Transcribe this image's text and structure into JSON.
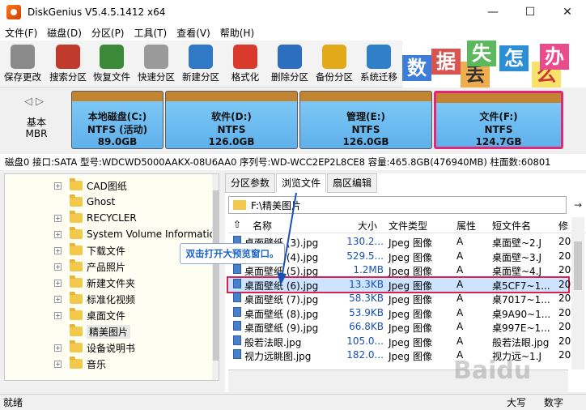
{
  "window": {
    "title": "DiskGenius V5.4.5.1412 x64",
    "minimize": "—",
    "maximize": "☐",
    "close": "✕"
  },
  "menu": [
    "文件(F)",
    "磁盘(D)",
    "分区(P)",
    "工具(T)",
    "查看(V)",
    "帮助(H)"
  ],
  "toolbar": [
    {
      "label": "保存更改",
      "color": "#8a8a8a"
    },
    {
      "label": "搜索分区",
      "color": "#c0392b"
    },
    {
      "label": "恢复文件",
      "color": "#3a8a3a"
    },
    {
      "label": "快速分区",
      "color": "#9a9a9a"
    },
    {
      "label": "新建分区",
      "color": "#2f79c6"
    },
    {
      "label": "格式化",
      "color": "#d93a2b"
    },
    {
      "label": "删除分区",
      "color": "#2c6fc0"
    },
    {
      "label": "备份分区",
      "color": "#e2a91b"
    },
    {
      "label": "系统迁移",
      "color": "#2f80c9"
    }
  ],
  "banner": [
    "数",
    "据",
    "丢",
    "失",
    "怎",
    "么",
    "办"
  ],
  "disk": {
    "nav": "◁ ▷",
    "label_line1": "基本",
    "label_line2": "MBR",
    "partitions": [
      {
        "name": "本地磁盘(C:)",
        "fs": "NTFS (活动)",
        "size": "89.0GB"
      },
      {
        "name": "软件(D:)",
        "fs": "NTFS",
        "size": "126.0GB"
      },
      {
        "name": "管理(E:)",
        "fs": "NTFS",
        "size": "126.0GB"
      },
      {
        "name": "文件(F:)",
        "fs": "NTFS",
        "size": "124.7GB"
      }
    ],
    "info": "磁盘0 接口:SATA  型号:WDCWD5000AAKX-08U6AA0  序列号:WD-WCC2EP2L8CE8  容量:465.8GB(476940MB)  柱面数:60801"
  },
  "tree": [
    {
      "label": "CAD图纸",
      "expander": "+"
    },
    {
      "label": "Ghost",
      "expander": ""
    },
    {
      "label": "RECYCLER",
      "expander": "+"
    },
    {
      "label": "System Volume Informatio",
      "expander": "+"
    },
    {
      "label": "下载文件",
      "expander": "+"
    },
    {
      "label": "产品照片",
      "expander": "+"
    },
    {
      "label": "新建文件夹",
      "expander": "+"
    },
    {
      "label": "标准化视频",
      "expander": "+"
    },
    {
      "label": "桌面文件",
      "expander": "+"
    },
    {
      "label": "精美图片",
      "expander": ""
    },
    {
      "label": "设备说明书",
      "expander": "+"
    },
    {
      "label": "音乐",
      "expander": "+"
    }
  ],
  "tabs": [
    "分区参数",
    "浏览文件",
    "扇区编辑"
  ],
  "path": "F:\\精美图片",
  "columns": {
    "name": "名称",
    "size": "大小",
    "type": "文件类型",
    "attr": "属性",
    "short": "短文件名",
    "mod": "修"
  },
  "files": [
    {
      "name": "桌面壁纸 (3).jpg",
      "size": "130.2...",
      "type": "Jpeg 图像",
      "attr": "A",
      "short": "桌面壁~2.J",
      "mod": "20"
    },
    {
      "name": "桌面壁纸 (4).jpg",
      "size": "529.5...",
      "type": "Jpeg 图像",
      "attr": "A",
      "short": "桌面壁~3.J",
      "mod": "20"
    },
    {
      "name": "桌面壁纸 (5).jpg",
      "size": "1.2MB",
      "type": "Jpeg 图像",
      "attr": "A",
      "short": "桌面壁~4.J",
      "mod": "20"
    },
    {
      "name": "桌面壁纸 (6).jpg",
      "size": "13.3KB",
      "type": "Jpeg 图像",
      "attr": "A",
      "short": "桌5CF7~1...",
      "mod": "20"
    },
    {
      "name": "桌面壁纸 (7).jpg",
      "size": "58.3KB",
      "type": "Jpeg 图像",
      "attr": "A",
      "short": "桌7017~1...",
      "mod": "20"
    },
    {
      "name": "桌面壁纸 (8).jpg",
      "size": "53.9KB",
      "type": "Jpeg 图像",
      "attr": "A",
      "short": "桌9A90~1...",
      "mod": "20"
    },
    {
      "name": "桌面壁纸 (9).jpg",
      "size": "66.8KB",
      "type": "Jpeg 图像",
      "attr": "A",
      "short": "桌997E~1...",
      "mod": "20"
    },
    {
      "name": "般若法眼.jpg",
      "size": "105.0...",
      "type": "Jpeg 图像",
      "attr": "A",
      "short": "般若法眼.jpg",
      "mod": "20"
    },
    {
      "name": "视力远眺图.jpg",
      "size": "182.0...",
      "type": "Jpeg 图像",
      "attr": "A",
      "short": "视力远~1.J",
      "mod": "20"
    }
  ],
  "highlight_index": 3,
  "tooltip": "双击打开大预览窗口。",
  "status": {
    "left": "就绪",
    "caps": "大写",
    "num": "数字"
  },
  "watermark": "Baidu"
}
